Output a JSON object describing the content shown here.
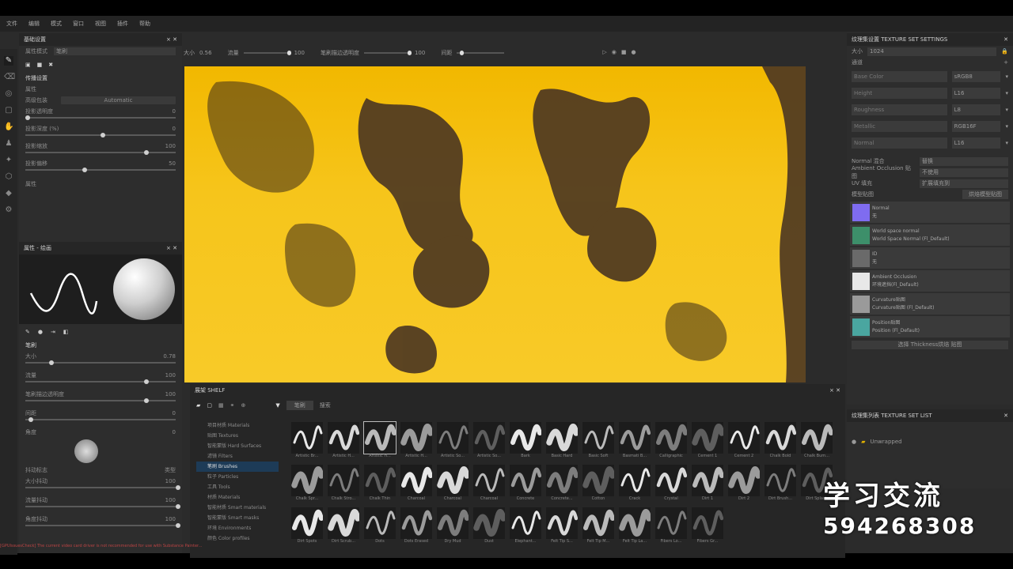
{
  "menu": [
    "文件",
    "编辑",
    "模式",
    "窗口",
    "视图",
    "插件",
    "帮助"
  ],
  "toolbar": {
    "size_label": "大小",
    "size_value": "0.56",
    "flow_label": "流量",
    "flow_value": "100",
    "stroke_label": "笔刷描边透明度",
    "stroke_value": "100",
    "spacing_label": "间距"
  },
  "left_panel": {
    "title": "基础设置",
    "property_label": "属性模式",
    "property_value": "笔刷",
    "section": "传播设置",
    "sub": "属性",
    "rows": [
      {
        "label": "高级包装",
        "value": "Automatic"
      },
      {
        "label": "投影透明度",
        "value": "0"
      },
      {
        "label": "投影深度 (%)",
        "value": "0"
      },
      {
        "label": "投影缩放",
        "value": "100"
      },
      {
        "label": "投影偏移",
        "value": "50"
      },
      {
        "label": "属性",
        "value": ""
      }
    ]
  },
  "brush_panel": {
    "title": "属性 - 绘画",
    "section": "笔刷",
    "params": [
      {
        "label": "大小",
        "value": "0.78"
      },
      {
        "label": "流量",
        "value": "100"
      },
      {
        "label": "笔刷描边透明度",
        "value": "100"
      },
      {
        "label": "间距",
        "value": "0"
      },
      {
        "label": "角度",
        "value": "0"
      },
      {
        "label": "抖动标志",
        "value": "类型"
      },
      {
        "label": "大小抖动",
        "value": "100"
      },
      {
        "label": "流量抖动",
        "value": "100"
      },
      {
        "label": "角度抖动",
        "value": "100"
      }
    ]
  },
  "texture_set": {
    "title": "纹理集设置 TEXTURE SET SETTINGS",
    "size_label": "大小",
    "size_value": "1024",
    "channels_label": "通道",
    "fields": [
      {
        "label": "Base Color",
        "value": "sRGB8"
      },
      {
        "label": "Height",
        "value": "L16"
      },
      {
        "label": "Roughness",
        "value": "L8"
      },
      {
        "label": "Metallic",
        "value": "RGB16F"
      },
      {
        "label": "Normal",
        "value": "L16"
      }
    ],
    "normal_label": "Normal 混合",
    "normal_value": "替换",
    "ao_label": "Ambient Occlusion 贴图",
    "ao_value": "不使用",
    "uv_label": "UV 填充",
    "uv_value": "扩展填充到",
    "maps_label": "模型贴图",
    "maps_button": "烘焙模型贴图",
    "maps": [
      {
        "name": "Normal",
        "sub": "无",
        "color": "#7f6cf0"
      },
      {
        "name": "World space normal",
        "sub": "World Space Normal (Fl_Default)",
        "color": "#3d8f6a"
      },
      {
        "name": "ID",
        "sub": "无",
        "color": "#6a6a6a"
      },
      {
        "name": "Ambient Occlusion",
        "sub": "环境遮挡(Fl_Default)",
        "color": "#e8e8e8"
      },
      {
        "name": "Curvature贴图",
        "sub": "Curvature贴图 (Fl_Default)",
        "color": "#9a9a9a"
      },
      {
        "name": "Position贴图",
        "sub": "Position (Fl_Default)",
        "color": "#4aa6a0"
      }
    ],
    "footer": "选择 Thickness烘焙 贴图"
  },
  "texture_list": {
    "title": "纹理集列表 TEXTURE SET LIST",
    "item": "Unwrapped"
  },
  "shelf": {
    "title": "展架 SHELF",
    "filter_tag": "笔刷",
    "search_placeholder": "搜索",
    "categories": [
      "项目材质 Materials",
      "贴图 Textures",
      "智能蒙版 Hard Surfaces",
      "滤镜 Filters",
      "笔刷 Brushes",
      "粒子 Particles",
      "工具 Tools",
      "材质 Materials",
      "智能材质 Smart materials",
      "智能蒙版 Smart masks",
      "环境 Environments",
      "颜色 Color profiles"
    ],
    "selected_category": 4,
    "brushes": [
      "Artistic Br...",
      "Artistic H...",
      "Artistic H...",
      "Artistic H...",
      "Artistic So...",
      "Artistic So...",
      "Bark",
      "Basic Hard",
      "Basic Soft",
      "Basmati B...",
      "Calligraphic",
      "Cement 1",
      "Cement 2",
      "Chalk Bold",
      "Chalk Bum...",
      "Chalk Spr...",
      "Chalk Stro...",
      "Chalk Thin",
      "Charcoal",
      "Charcoal",
      "Charcoal",
      "Concrete",
      "Concrete...",
      "Cotton",
      "Crack",
      "Crystal",
      "Dirt 1",
      "Dirt 2",
      "Dirt Brush...",
      "Dirt Splash",
      "Dirt Spots",
      "Dirt Scrub...",
      "Dots",
      "Dots Erased",
      "Dry Mud",
      "Dust",
      "Elephant...",
      "Felt Tip S...",
      "Felt Tip M...",
      "Felt Tip La...",
      "Fibers Lo...",
      "Fibers Gr..."
    ],
    "selected_brush": 2
  },
  "status_text": "[GPUIssuesCheck] The current video card driver is not recommended for use with Substance Painter...",
  "watermark": {
    "line1": "学习交流",
    "line2": "594268308"
  },
  "colors": {
    "accent": "#1d3b57",
    "paint_yellow": "#f5c21a"
  }
}
